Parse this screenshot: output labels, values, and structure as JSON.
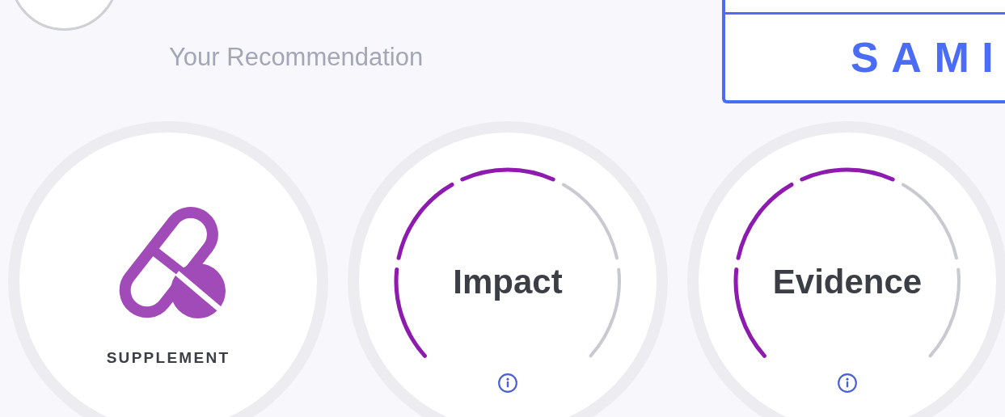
{
  "header": {
    "subtitle": "Your Recommendation"
  },
  "button": {
    "label": "SAMI"
  },
  "cards": [
    {
      "kind": "category",
      "label": "SUPPLEMENT"
    },
    {
      "kind": "gauge",
      "label": "Impact",
      "segments": [
        {
          "filled": true
        },
        {
          "filled": true
        },
        {
          "filled": true
        },
        {
          "filled": false
        },
        {
          "filled": false
        }
      ]
    },
    {
      "kind": "gauge",
      "label": "Evidence",
      "segments": [
        {
          "filled": true
        },
        {
          "filled": true
        },
        {
          "filled": true
        },
        {
          "filled": false
        },
        {
          "filled": false
        }
      ]
    }
  ]
}
